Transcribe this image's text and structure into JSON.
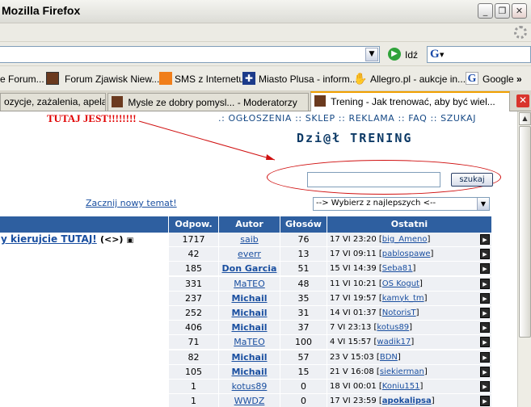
{
  "window": {
    "title": "Mozilla Firefox"
  },
  "navbar": {
    "go_label": "Idź",
    "search_engine": "G"
  },
  "bookmarks": [
    {
      "label": "e Forum...",
      "icon": "none"
    },
    {
      "label": "Forum Zjawisk Niew...",
      "icon": "site-icon"
    },
    {
      "label": "SMS z Internetu",
      "icon": "orange-icon"
    },
    {
      "label": "Miasto Plusa - inform...",
      "icon": "plus-icon"
    },
    {
      "label": "Allegro.pl - aukcje in...",
      "icon": "hand-icon"
    },
    {
      "label": "Google",
      "icon": "google-icon"
    }
  ],
  "bookmarks_overflow": "»",
  "tabs": [
    {
      "label": "ozycje, zażalenia, apela..."
    },
    {
      "label": "Mysle ze dobry pomysl... - Moderatorzy"
    },
    {
      "label": "Trening - Jak trenować, aby być wiel...",
      "active": true
    }
  ],
  "page": {
    "annotation": "TUTAJ JEST!!!!!!!!",
    "topnav": ".: OGŁOSZENIA :: SKLEP :: REKLAMA :: FAQ :: SZUKAJ",
    "section_title": "Dzi@ł TRENING",
    "search_button": "szukaj",
    "new_topic": "Zacznij nowy temat!",
    "best_select": "--> Wybierz z najlepszych <--"
  },
  "table": {
    "headers": [
      "Odpow.",
      "Autor",
      "Głosów",
      "Ostatni"
    ],
    "rows": [
      {
        "topic": "y kierujcie TUTAJ!",
        "topic_extra": "(<>)",
        "replies": "1717",
        "author": "saib",
        "author_bold": false,
        "votes": "76",
        "last_time": "17 VI 23:20",
        "last_user": "big_Ameno",
        "last_bold": false
      },
      {
        "topic": "",
        "topic_extra": "",
        "replies": "42",
        "author": "everr",
        "author_bold": false,
        "votes": "13",
        "last_time": "17 VI 09:11",
        "last_user": "pablospawe",
        "last_bold": false
      },
      {
        "topic": "",
        "topic_extra": "",
        "replies": "185",
        "author": "Don Garcia",
        "author_bold": true,
        "votes": "51",
        "last_time": "15 VI 14:39",
        "last_user": "Seba81",
        "last_bold": false
      },
      {
        "topic": "",
        "topic_extra": "",
        "replies": "331",
        "author": "MaTEO",
        "author_bold": false,
        "votes": "48",
        "last_time": "11 VI 10:21",
        "last_user": "OS Kogut",
        "last_bold": false
      },
      {
        "topic": "",
        "topic_extra": "",
        "replies": "237",
        "author": "Michail",
        "author_bold": true,
        "votes": "35",
        "last_time": "17 VI 19:57",
        "last_user": "kamyk_tm",
        "last_bold": false
      },
      {
        "topic": "",
        "topic_extra": "",
        "replies": "252",
        "author": "Michail",
        "author_bold": true,
        "votes": "31",
        "last_time": "14 VI 01:37",
        "last_user": "NotorisT",
        "last_bold": false
      },
      {
        "topic": "",
        "topic_extra": "",
        "replies": "406",
        "author": "Michail",
        "author_bold": true,
        "votes": "37",
        "last_time": "7 VI 23:13",
        "last_user": "kotus89",
        "last_bold": false
      },
      {
        "topic": "",
        "topic_extra": "",
        "replies": "71",
        "author": "MaTEO",
        "author_bold": false,
        "votes": "100",
        "last_time": "4 VI 15:57",
        "last_user": "wadik17",
        "last_bold": false
      },
      {
        "topic": "",
        "topic_extra": "",
        "replies": "82",
        "author": "Michail",
        "author_bold": true,
        "votes": "57",
        "last_time": "23 V 15:03",
        "last_user": "BDN",
        "last_bold": false
      },
      {
        "topic": "",
        "topic_extra": "",
        "replies": "105",
        "author": "Michail",
        "author_bold": true,
        "votes": "15",
        "last_time": "21 V 16:08",
        "last_user": "siekierman",
        "last_bold": false
      },
      {
        "topic": "",
        "topic_extra": "",
        "replies": "1",
        "author": "kotus89",
        "author_bold": false,
        "votes": "0",
        "last_time": "18 VI 00:01",
        "last_user": "Koniu151",
        "last_bold": false
      },
      {
        "topic": "",
        "topic_extra": "",
        "replies": "1",
        "author": "WWDZ",
        "author_bold": false,
        "votes": "0",
        "last_time": "17 VI 23:59",
        "last_user": "apokalipsa",
        "last_bold": true
      }
    ]
  },
  "colors": {
    "header_bg": "#2e5fa0",
    "link": "#1a4fa0",
    "annotation": "#e00000",
    "cell_bg": "#eef0f4"
  }
}
